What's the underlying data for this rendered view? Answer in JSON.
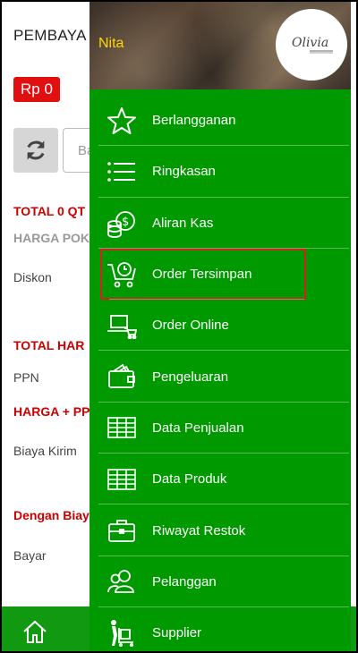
{
  "page": {
    "title": "PEMBAYA",
    "price": "Rp 0",
    "search_placeholder": "Ba",
    "total_qty": "TOTAL 0 QT",
    "harga_pokok": "HARGA POK",
    "diskon": "Diskon",
    "total_harga": "TOTAL HAR",
    "ppn": "PPN",
    "harga_ppn": "HARGA + PP",
    "biaya_kirim": "Biaya Kirim",
    "dengan_biaya": "Dengan Biay",
    "bayar": "Bayar"
  },
  "drawer": {
    "user_name": "Nita",
    "logo_text": "Olivia",
    "menu": [
      {
        "label": "Berlangganan",
        "icon": "star-icon"
      },
      {
        "label": "Ringkasan",
        "icon": "list-icon"
      },
      {
        "label": "Aliran Kas",
        "icon": "coins-icon"
      },
      {
        "label": "Order Tersimpan",
        "icon": "cart-clock-icon"
      },
      {
        "label": "Order Online",
        "icon": "laptop-cart-icon"
      },
      {
        "label": "Pengeluaran",
        "icon": "wallet-icon"
      },
      {
        "label": "Data Penjualan",
        "icon": "table-icon"
      },
      {
        "label": "Data Produk",
        "icon": "table-icon"
      },
      {
        "label": "Riwayat Restok",
        "icon": "briefcase-icon"
      },
      {
        "label": "Pelanggan",
        "icon": "users-icon"
      },
      {
        "label": "Supplier",
        "icon": "dolly-icon"
      }
    ]
  },
  "colors": {
    "drawer_bg": "#009900",
    "accent_red": "#cc0000",
    "user_name": "#ffd700"
  }
}
